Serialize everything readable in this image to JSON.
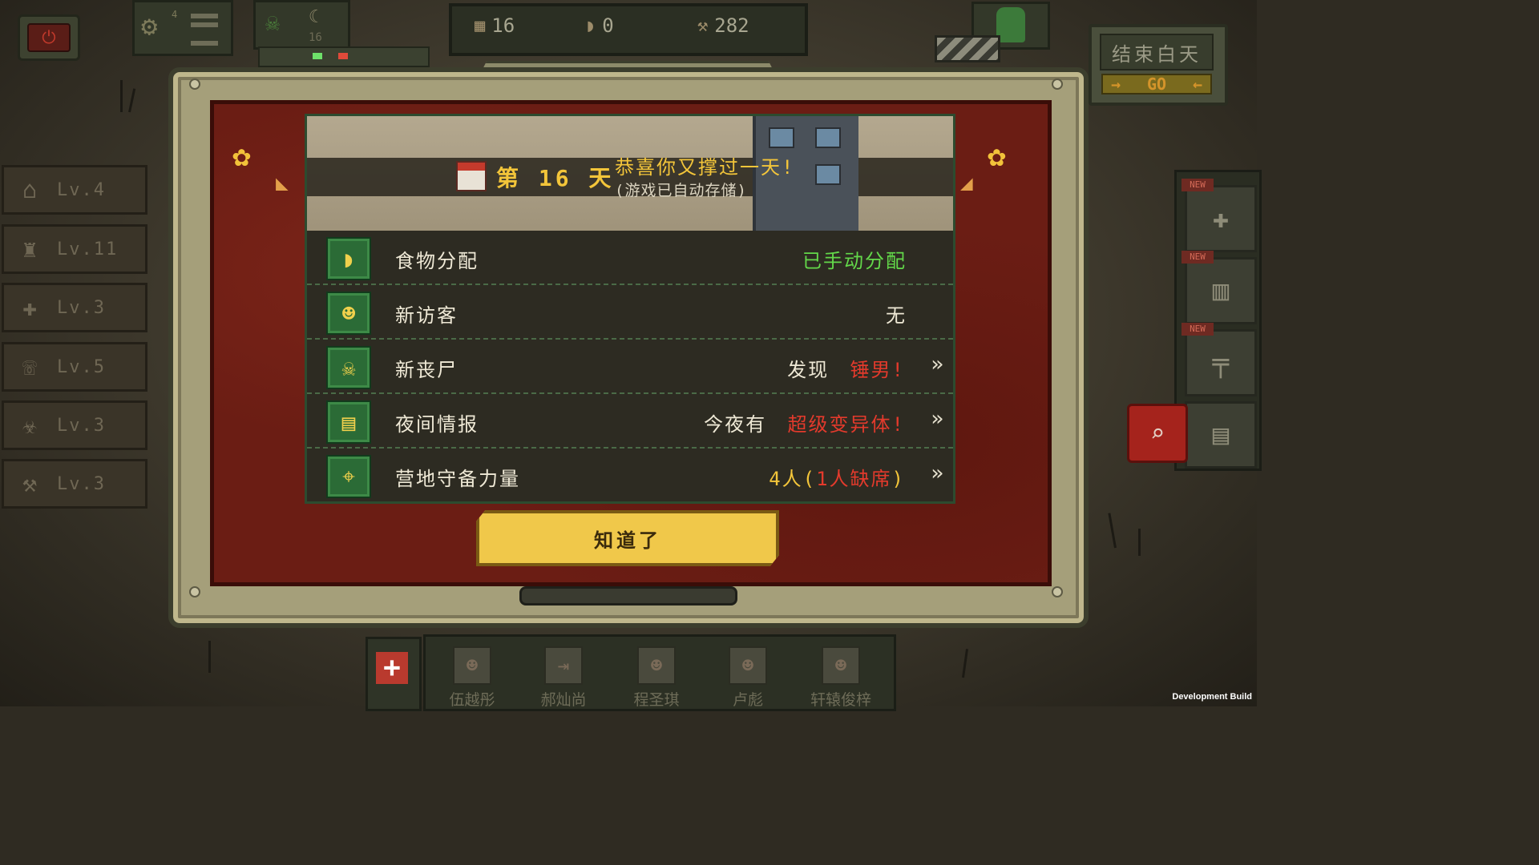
{
  "hud": {
    "menu_badge": "4",
    "skull_count": "16",
    "stats": {
      "day": "16",
      "food": "0",
      "scrap": "282"
    },
    "end_day": {
      "title": "结束白天",
      "go_label": "GO"
    }
  },
  "left_panel": [
    {
      "icon": "home-icon",
      "level": "Lv.4"
    },
    {
      "icon": "turret-icon",
      "level": "Lv.11"
    },
    {
      "icon": "medkit-icon",
      "level": "Lv.3"
    },
    {
      "icon": "radio-icon",
      "level": "Lv.5"
    },
    {
      "icon": "biohazard-icon",
      "level": "Lv.3"
    },
    {
      "icon": "anvil-icon",
      "level": "Lv.3"
    }
  ],
  "right_panel": {
    "new_label": "NEW",
    "slots": [
      "medkit-icon",
      "supplies-icon",
      "rifle-icon",
      "map-icon"
    ]
  },
  "dialog": {
    "day_text": "第 16 天",
    "congrats": "恭喜你又撑过一天!",
    "autosave": "(游戏已自动存储)",
    "rows": [
      {
        "icon": "bread-icon",
        "label": "食物分配",
        "value": "已手动分配",
        "has_arrow": false
      },
      {
        "icon": "visitor-icon",
        "label": "新访客",
        "value": "无",
        "has_arrow": false
      },
      {
        "icon": "skull-icon",
        "label": "新丧尸",
        "value_prefix": "发现",
        "value_highlight": "锤男!",
        "has_arrow": true
      },
      {
        "icon": "report-icon",
        "label": "夜间情报",
        "value_prefix": "今夜有",
        "value_highlight": "超级变异体!",
        "has_arrow": true
      },
      {
        "icon": "camp-icon",
        "label": "营地守备力量",
        "value_prefix": "4人(",
        "value_highlight": "1人缺席",
        "value_suffix": ")",
        "has_arrow": true
      }
    ],
    "ok_button": "知道了"
  },
  "bottom_bar": {
    "characters": [
      "伍越彤",
      "郝灿尚",
      "程圣琪",
      "卢彪",
      "轩辕俊梓"
    ]
  },
  "dev_build": "Development Build",
  "colors": {
    "accent_yellow": "#f3c53a",
    "alert_red": "#e33a2c",
    "status_green": "#63d84a",
    "panel_red": "#6b1d14"
  }
}
